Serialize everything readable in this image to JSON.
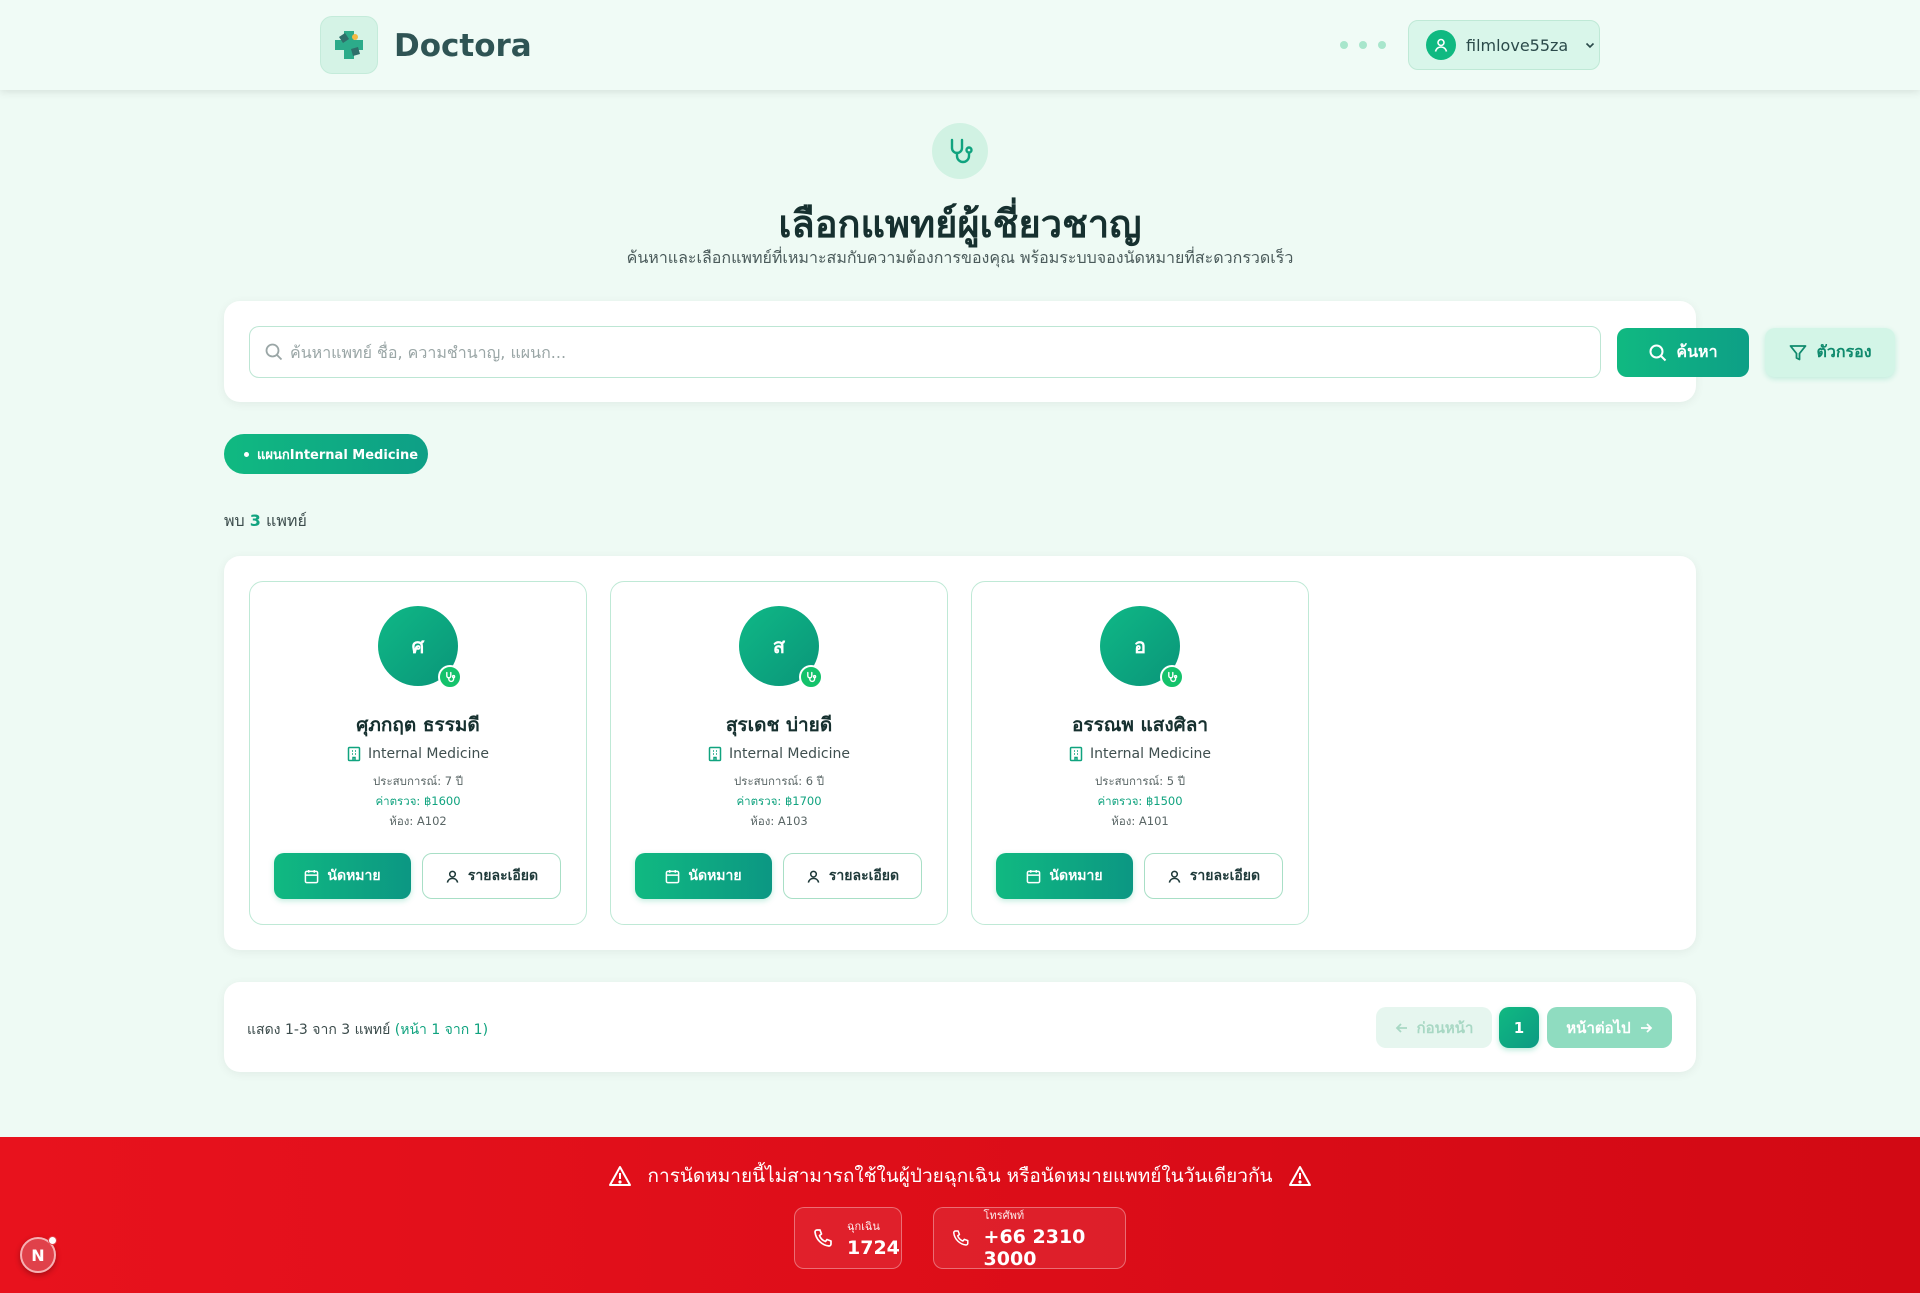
{
  "header": {
    "brand": "Doctora",
    "username": "filmlove55za"
  },
  "hero": {
    "title": "เลือกแพทย์ผู้เชี่ยวชาญ",
    "subtitle": "ค้นหาและเลือกแพทย์ที่เหมาะสมกับความต้องการของคุณ พร้อมระบบจองนัดหมายที่สะดวกรวดเร็ว"
  },
  "search": {
    "placeholder": "ค้นหาแพทย์ ชื่อ, ความชำนาญ, แผนก...",
    "value": "",
    "search_label": "ค้นหา",
    "filter_label": "ตัวกรอง"
  },
  "active_filter": "แผนกInternal Medicine",
  "results": {
    "prefix": "พบ",
    "count": "3",
    "suffix": "แพทย์"
  },
  "doctors": [
    {
      "initial": "ศ",
      "name": "ศุภกฤต ธรรมดี",
      "department": "Internal Medicine",
      "experience": "ประสบการณ์: 7 ปี",
      "fee": "ค่าตรวจ: ฿1600",
      "room": "ห้อง: A102",
      "book_label": "นัดหมาย",
      "detail_label": "รายละเอียด"
    },
    {
      "initial": "ส",
      "name": "สุรเดช บ่ายดี",
      "department": "Internal Medicine",
      "experience": "ประสบการณ์: 6 ปี",
      "fee": "ค่าตรวจ: ฿1700",
      "room": "ห้อง: A103",
      "book_label": "นัดหมาย",
      "detail_label": "รายละเอียด"
    },
    {
      "initial": "อ",
      "name": "อรรณพ แสงศิลา",
      "department": "Internal Medicine",
      "experience": "ประสบการณ์: 5 ปี",
      "fee": "ค่าตรวจ: ฿1500",
      "room": "ห้อง: A101",
      "book_label": "นัดหมาย",
      "detail_label": "รายละเอียด"
    }
  ],
  "pagination": {
    "info": "แสดง 1-3 จาก 3 แพทย์",
    "page_info": "(หน้า 1 จาก 1)",
    "prev_label": "ก่อนหน้า",
    "current_page": "1",
    "next_label": "หน้าต่อไป"
  },
  "emergency": {
    "warning": "การนัดหมายนี้ไม่สามารถใช้ในผู้ป่วยฉุกเฉิน หรือนัดหมายแพทย์ในวันเดียวกัน",
    "contacts": [
      {
        "label": "ฉุกเฉิน",
        "number": "1724"
      },
      {
        "label": "โทรศัพท์",
        "number": "+66 2310 3000"
      }
    ]
  },
  "dev_badge": "N",
  "colors": {
    "accent": "#10b981",
    "accent_dark": "#0d9f86",
    "page_bg": "#eefaf4",
    "emergency_red": "#e8121d",
    "title_text": "#16302f"
  },
  "icons": {
    "logo": "medical-cross-icon",
    "user": "user-icon",
    "search": "search-icon",
    "filter": "filter-icon",
    "stethoscope": "stethoscope-icon",
    "department": "hospital-building-icon",
    "calendar": "calendar-icon",
    "phone": "phone-icon",
    "warning": "warning-triangle-icon",
    "arrow_left": "arrow-left-icon",
    "arrow_right": "arrow-right-icon"
  }
}
